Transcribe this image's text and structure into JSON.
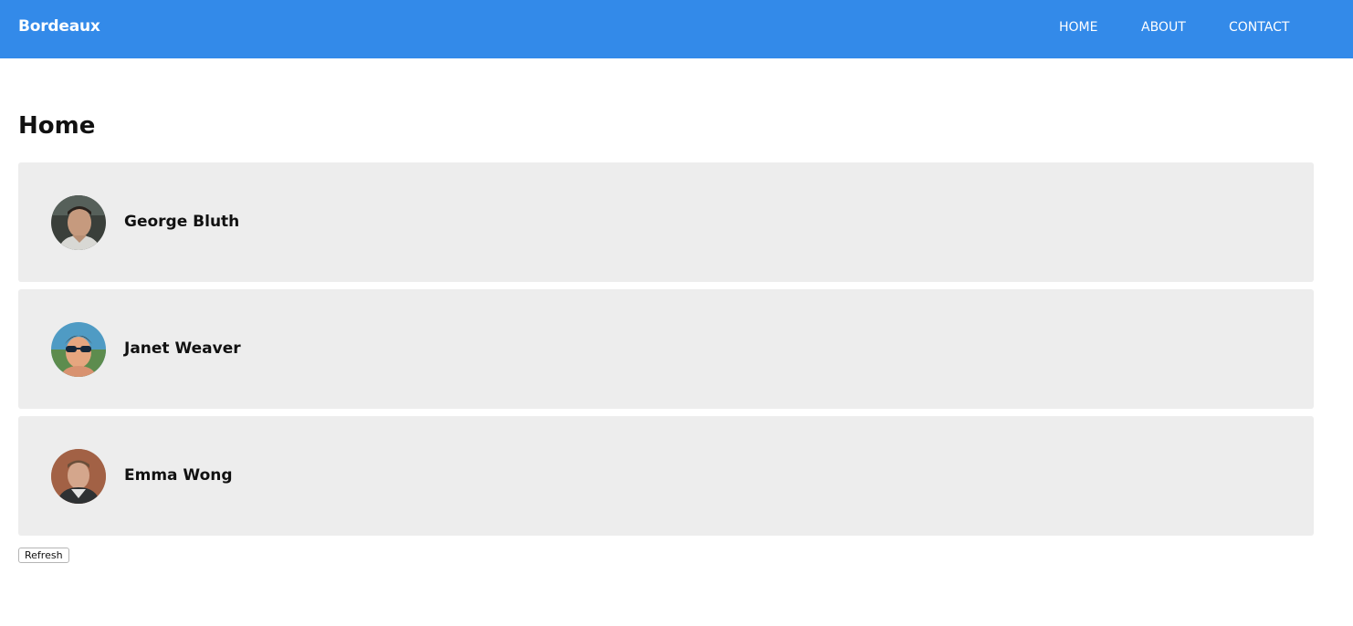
{
  "app": {
    "brand": "Bordeaux"
  },
  "nav": {
    "items": [
      {
        "label": "HOME"
      },
      {
        "label": "ABOUT"
      },
      {
        "label": "CONTACT"
      }
    ]
  },
  "page": {
    "title": "Home"
  },
  "users": [
    {
      "name": "George Bluth",
      "avatar_icon": "avatar-photo-george"
    },
    {
      "name": "Janet Weaver",
      "avatar_icon": "avatar-photo-janet"
    },
    {
      "name": "Emma Wong",
      "avatar_icon": "avatar-photo-emma"
    }
  ],
  "actions": {
    "refresh_label": "Refresh"
  },
  "colors": {
    "navbar_bg": "#338ae9",
    "card_bg": "#ededed",
    "text": "#111111"
  }
}
